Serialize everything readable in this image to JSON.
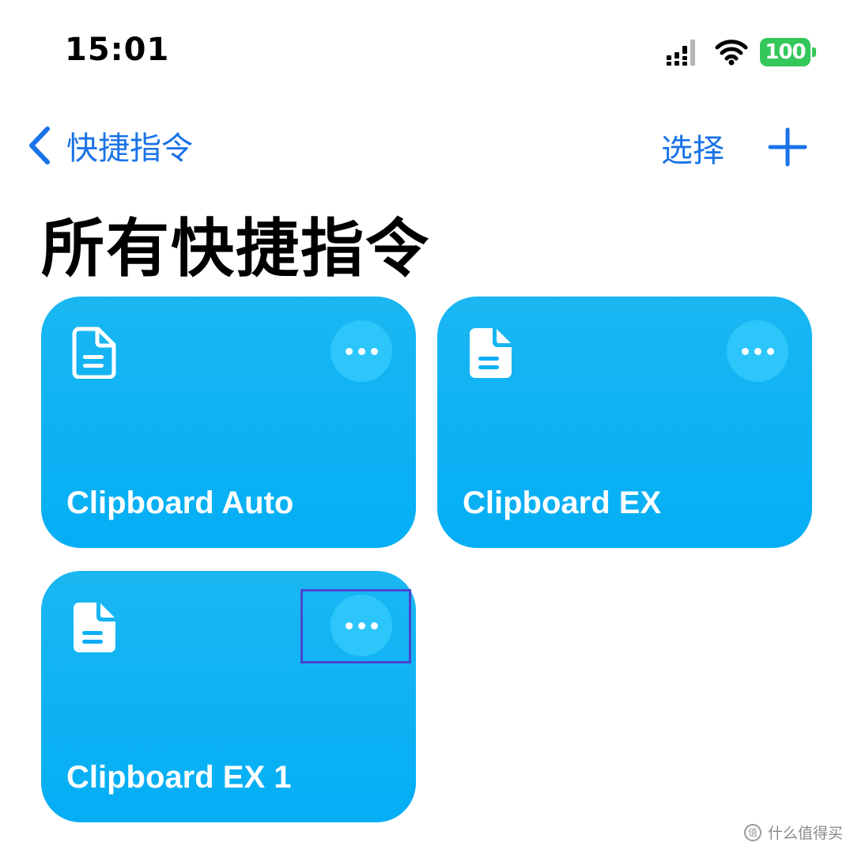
{
  "colors": {
    "accent": "#1a73e8",
    "card": "#0aaef5",
    "battery": "#34c759",
    "highlight": "#4a45d0"
  },
  "status_bar": {
    "time": "15:01",
    "battery_level": "100",
    "icons": [
      "signal-icon",
      "wifi-icon",
      "battery-icon"
    ]
  },
  "nav": {
    "back_label": "快捷指令",
    "select_label": "选择",
    "add_icon": "plus-icon"
  },
  "page_title": "所有快捷指令",
  "shortcuts": [
    {
      "title": "Clipboard Auto",
      "icon": "document-outline-icon"
    },
    {
      "title": "Clipboard EX",
      "icon": "document-icon"
    },
    {
      "title": "Clipboard EX 1",
      "icon": "document-icon"
    }
  ],
  "watermark": {
    "text": "什么值得买",
    "icon": "值"
  }
}
